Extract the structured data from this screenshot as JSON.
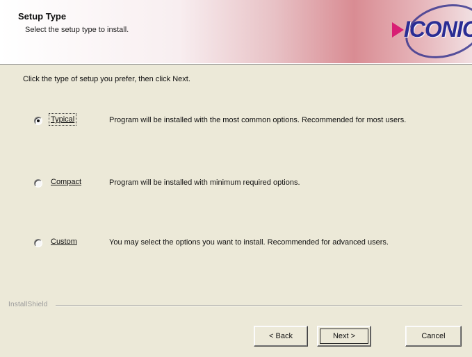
{
  "header": {
    "title": "Setup Type",
    "subtitle": "Select the setup type to install.",
    "logo_text": "ICONICS"
  },
  "prompt": "Click the type of setup you prefer, then click Next.",
  "options": [
    {
      "label": "Typical",
      "description": "Program will be installed with the most common options.  Recommended for most users.",
      "selected": true
    },
    {
      "label": "Compact",
      "description": "Program will be installed with minimum required options.",
      "selected": false
    },
    {
      "label": "Custom",
      "description": "You may select the options you want to install. Recommended for advanced users.",
      "selected": false
    }
  ],
  "footer": {
    "separator_text": "InstallShield",
    "buttons": {
      "back": "< Back",
      "next": "Next >",
      "cancel": "Cancel"
    }
  },
  "colors": {
    "window_background": "#ece9d8",
    "header_pink": "#d98c93",
    "logo_blue": "#2a2d94",
    "logo_magenta": "#d81f74"
  }
}
